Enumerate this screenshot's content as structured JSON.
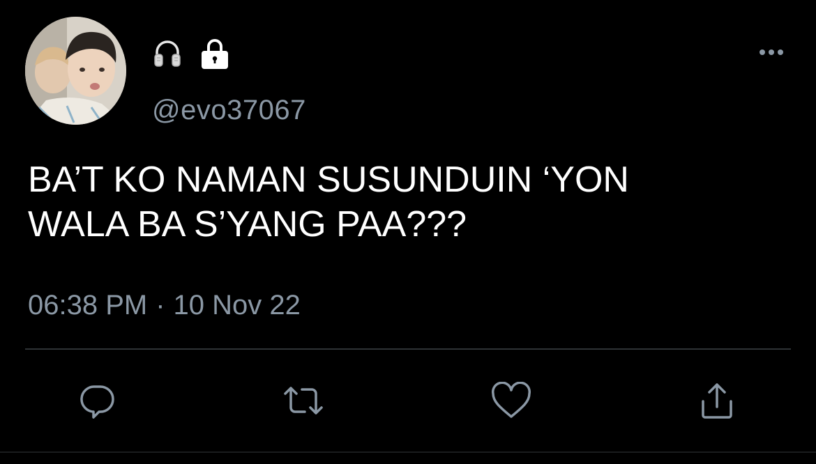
{
  "tweet": {
    "handle": "@evo37067",
    "name_icons": [
      "headphones-icon",
      "lock-icon"
    ],
    "text": "BA’T KO NAMAN SUSUNDUIN ‘YON\nWALA BA S’YANG PAA???",
    "time": "06:38 PM",
    "separator": "·",
    "date": "10 Nov 22"
  },
  "actions": [
    "reply-icon",
    "retweet-icon",
    "like-icon",
    "share-icon"
  ],
  "colors": {
    "background": "#000000",
    "text": "#ffffff",
    "secondary": "#8b98a5",
    "divider": "#2f3336"
  }
}
